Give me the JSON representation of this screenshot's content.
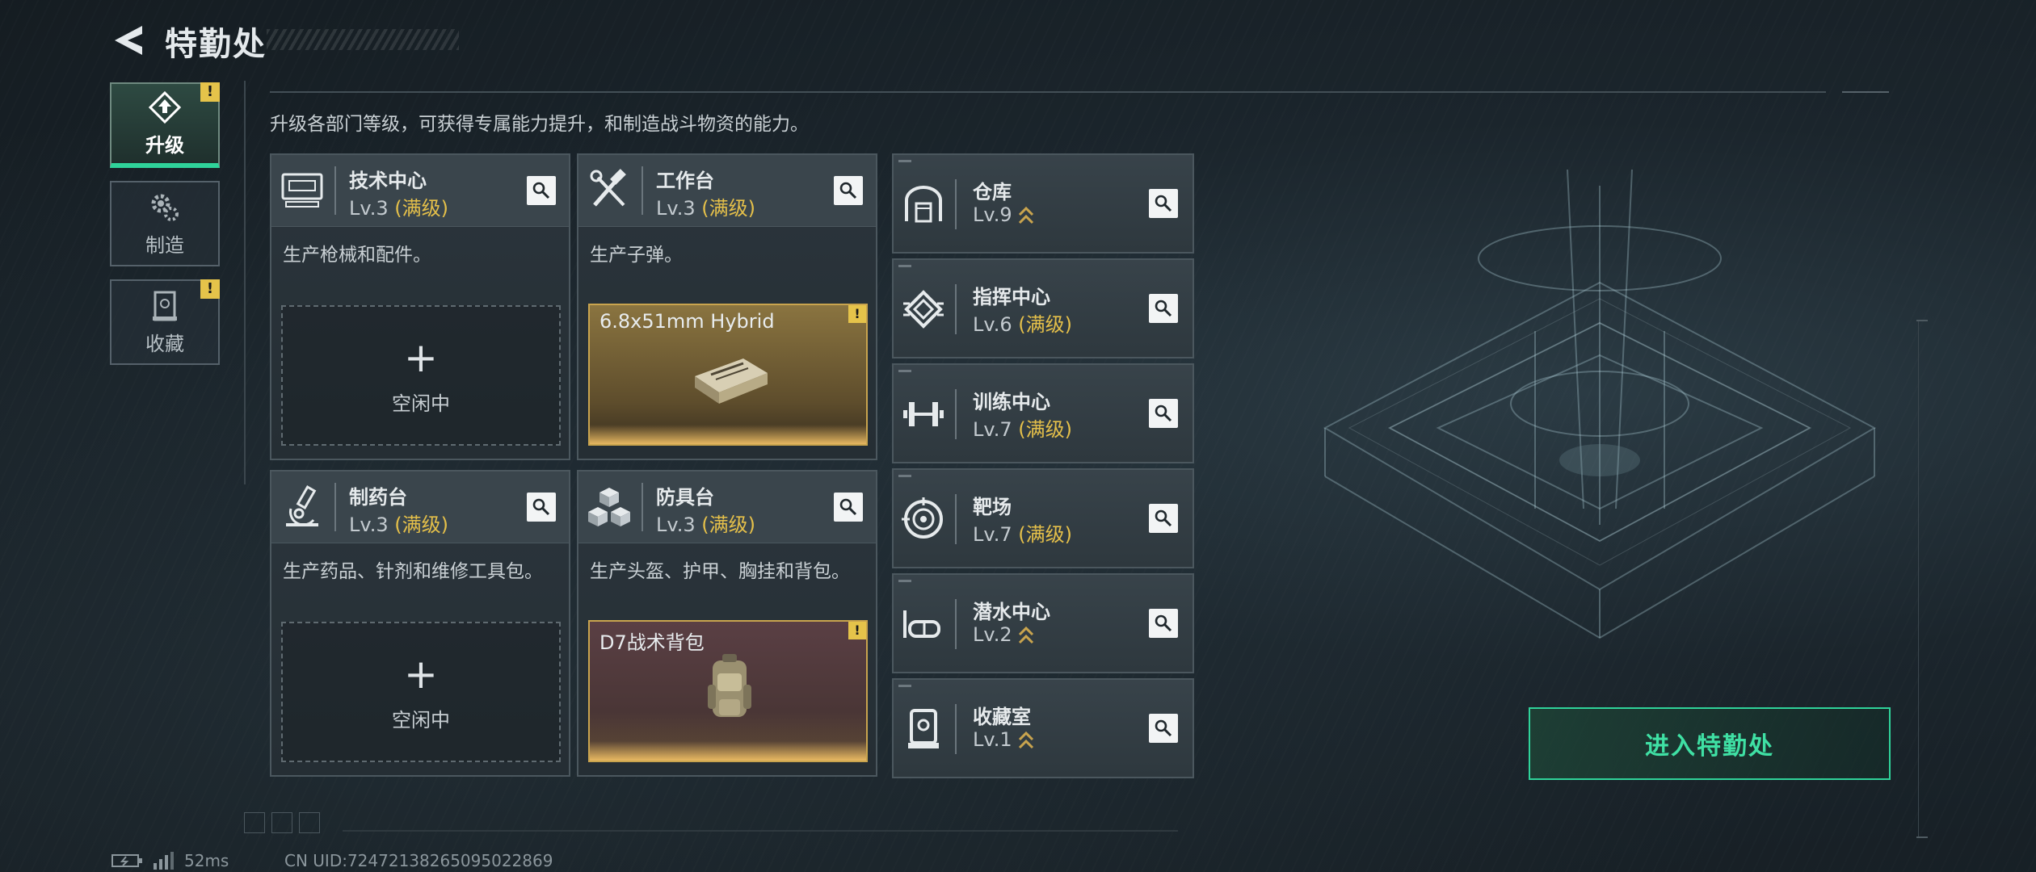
{
  "header": {
    "title": "特勤处"
  },
  "tabs": [
    {
      "label": "升级",
      "icon": "upgrade-icon",
      "active": true,
      "alert": "!"
    },
    {
      "label": "制造",
      "icon": "gears-icon",
      "active": false,
      "alert": ""
    },
    {
      "label": "收藏",
      "icon": "collection-icon",
      "active": false,
      "alert": "!"
    }
  ],
  "main": {
    "description": "升级各部门等级，可获得专属能力提升，和制造战斗物资的能力。",
    "facilities": [
      {
        "name": "技术中心",
        "level": "Lv.3",
        "status": "(满级)",
        "desc": "生产枪械和配件。",
        "slot": {
          "type": "empty",
          "plus": "+",
          "label": "空闲中"
        },
        "icon": "monitor-icon"
      },
      {
        "name": "工作台",
        "level": "Lv.3",
        "status": "(满级)",
        "desc": "生产子弹。",
        "slot": {
          "type": "item",
          "item_name": "6.8x51mm Hybrid",
          "alert": "!",
          "bg": "#8a7440"
        },
        "icon": "tools-icon"
      },
      {
        "name": "制药台",
        "level": "Lv.3",
        "status": "(满级)",
        "desc": "生产药品、针剂和维修工具包。",
        "slot": {
          "type": "empty",
          "plus": "+",
          "label": "空闲中"
        },
        "icon": "microscope-icon"
      },
      {
        "name": "防具台",
        "level": "Lv.3",
        "status": "(满级)",
        "desc": "生产头盔、护甲、胸挂和背包。",
        "slot": {
          "type": "item",
          "item_name": "D7战术背包",
          "alert": "!",
          "bg": "#5a3f44"
        },
        "icon": "cubes-icon"
      }
    ],
    "departments": [
      {
        "name": "仓库",
        "level": "Lv.9",
        "status": "",
        "upgradable": true,
        "icon": "warehouse-icon"
      },
      {
        "name": "指挥中心",
        "level": "Lv.6",
        "status": "(满级)",
        "upgradable": false,
        "icon": "chip-icon"
      },
      {
        "name": "训练中心",
        "level": "Lv.7",
        "status": "(满级)",
        "upgradable": false,
        "icon": "dumbbell-icon"
      },
      {
        "name": "靶场",
        "level": "Lv.7",
        "status": "(满级)",
        "upgradable": false,
        "icon": "target-icon"
      },
      {
        "name": "潜水中心",
        "level": "Lv.2",
        "status": "",
        "upgradable": true,
        "icon": "diving-mask-icon"
      },
      {
        "name": "收藏室",
        "level": "Lv.1",
        "status": "",
        "upgradable": true,
        "icon": "display-case-icon"
      }
    ]
  },
  "enter_button": {
    "label": "进入特勤处"
  },
  "footer": {
    "ping": "52ms",
    "uid": "CN UID:72472138265095022869"
  },
  "colors": {
    "accent": "#2fd39a",
    "maxed": "#e5c04a",
    "alert": "#e5c34a"
  }
}
